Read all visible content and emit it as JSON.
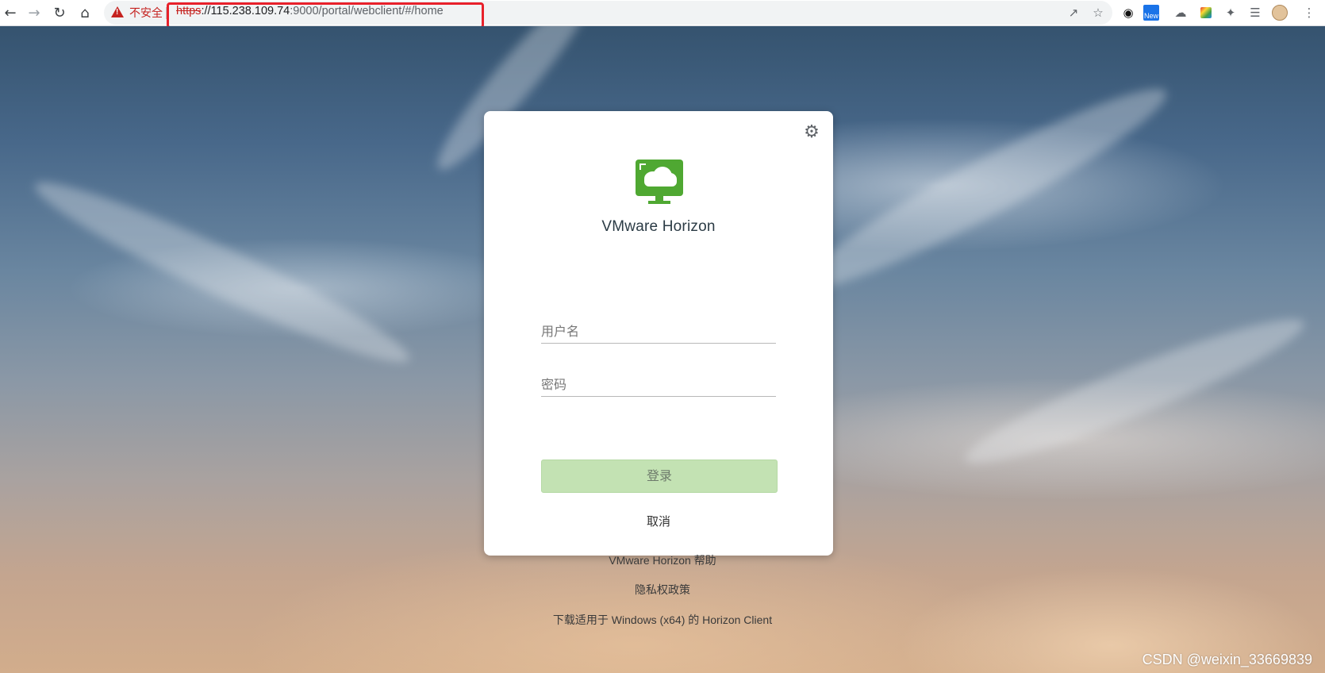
{
  "browser": {
    "security_label": "不安全",
    "url_scheme": "https",
    "url_host": "://115.238.109.74",
    "url_path": ":9000/portal/webclient/#/home",
    "extensions": [
      "ghost-ext-icon",
      "new-badge-ext-icon",
      "cloud-ext-icon",
      "rainbow-ext-icon",
      "puzzle-icon",
      "reading-list-icon",
      "profile-avatar"
    ]
  },
  "login": {
    "product_name": "VMware Horizon",
    "username_placeholder": "用户名",
    "password_placeholder": "密码",
    "login_label": "登录",
    "cancel_label": "取消"
  },
  "footer": {
    "help": "VMware Horizon 帮助",
    "privacy": "隐私权政策",
    "download": "下载适用于 Windows (x64) 的 Horizon Client"
  },
  "watermark": "CSDN @weixin_33669839",
  "colors": {
    "brand_green": "#4fa832",
    "login_button_bg": "#c3e2b3",
    "insecure_red": "#c5221f",
    "highlight_red": "#e8212b"
  }
}
